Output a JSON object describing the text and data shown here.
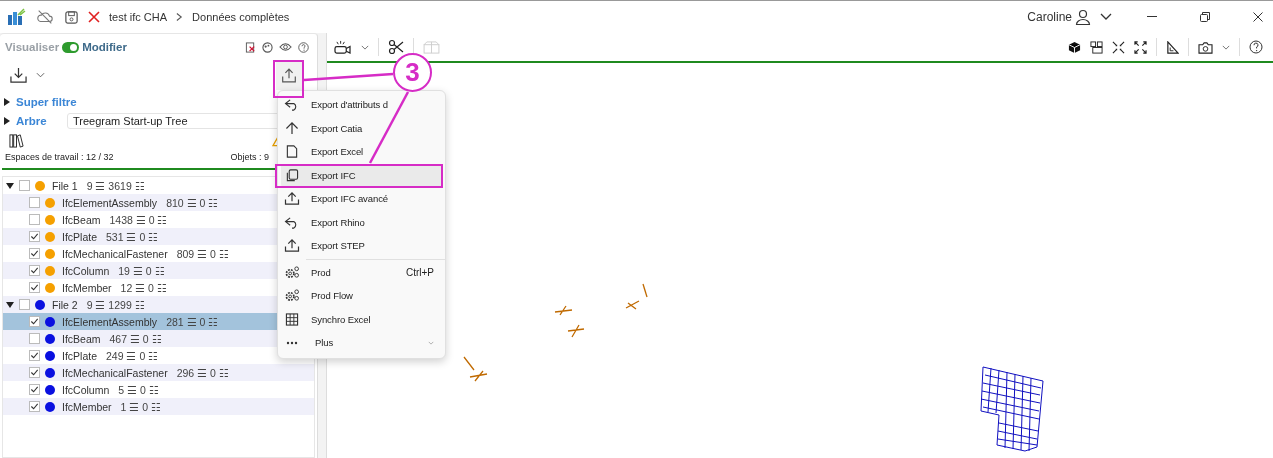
{
  "app": {
    "project": "test ifc CHA",
    "view": "Données complètes",
    "user": "Caroline"
  },
  "mode": {
    "left": "Visualiser",
    "right": "Modifier",
    "on": true
  },
  "filters": [
    {
      "label": "Super filtre",
      "expanded": false
    },
    {
      "label": "Arbre",
      "expanded": false,
      "value": "Treegram Start-up Tree"
    }
  ],
  "workspace": {
    "spaces": "Espaces de travail : 12 / 32",
    "objects": "Objets : 9"
  },
  "tree": [
    {
      "label": "File 1",
      "counts": "9 ☰ 3619 ☷",
      "color": "#f5a000",
      "checked": false,
      "expanded": true,
      "selected": false,
      "children": [
        {
          "label": "IfcElementAssembly",
          "counts": "810 ☰ 0 ☷",
          "color": "#f5a000",
          "checked": false,
          "selected": false
        },
        {
          "label": "IfcBeam",
          "counts": "1438 ☰ 0 ☷",
          "color": "#f5a000",
          "checked": false,
          "selected": false
        },
        {
          "label": "IfcPlate",
          "counts": "531 ☰ 0 ☷",
          "color": "#f5a000",
          "checked": true,
          "selected": false
        },
        {
          "label": "IfcMechanicalFastener",
          "counts": "809 ☰ 0 ☷",
          "color": "#f5a000",
          "checked": true,
          "selected": false
        },
        {
          "label": "IfcColumn",
          "counts": "19 ☰ 0 ☷",
          "color": "#f5a000",
          "checked": true,
          "selected": false
        },
        {
          "label": "IfcMember",
          "counts": "12 ☰ 0 ☷",
          "color": "#f5a000",
          "checked": true,
          "selected": false
        }
      ]
    },
    {
      "label": "File 2",
      "counts": "9 ☰ 1299 ☷",
      "color": "#0a10e0",
      "checked": false,
      "expanded": true,
      "selected": false,
      "children": [
        {
          "label": "IfcElementAssembly",
          "counts": "281 ☰ 0 ☷",
          "color": "#0a10e0",
          "checked": true,
          "selected": true
        },
        {
          "label": "IfcBeam",
          "counts": "467 ☰ 0 ☷",
          "color": "#0a10e0",
          "checked": false,
          "selected": false
        },
        {
          "label": "IfcPlate",
          "counts": "249 ☰ 0 ☷",
          "color": "#0a10e0",
          "checked": true,
          "selected": false
        },
        {
          "label": "IfcMechanicalFastener",
          "counts": "296 ☰ 0 ☷",
          "color": "#0a10e0",
          "checked": true,
          "selected": false
        },
        {
          "label": "IfcColumn",
          "counts": "5 ☰ 0 ☷",
          "color": "#0a10e0",
          "checked": true,
          "selected": false
        },
        {
          "label": "IfcMember",
          "counts": "1 ☰ 0 ☷",
          "color": "#0a10e0",
          "checked": true,
          "selected": false
        }
      ]
    }
  ],
  "menu": [
    {
      "label": "Export d'attributs d",
      "kind": "item",
      "selected": false
    },
    {
      "label": "Export Catia",
      "kind": "item",
      "selected": false
    },
    {
      "label": "Export Excel",
      "kind": "item",
      "selected": false
    },
    {
      "label": "Export IFC",
      "kind": "item",
      "selected": true
    },
    {
      "label": "Export IFC avancé",
      "kind": "item",
      "selected": false
    },
    {
      "label": "Export Rhino",
      "kind": "item",
      "selected": false
    },
    {
      "label": "Export STEP",
      "kind": "item",
      "selected": false
    },
    {
      "label": "Prod",
      "kind": "item",
      "selected": false,
      "divider_before": true,
      "shortcut": "Ctrl+P"
    },
    {
      "label": "Prod Flow",
      "kind": "item",
      "selected": false
    },
    {
      "label": "Synchro Excel",
      "kind": "item",
      "selected": false
    },
    {
      "label": "Plus",
      "kind": "submenu",
      "selected": false
    }
  ],
  "annotation": {
    "label": "3"
  }
}
